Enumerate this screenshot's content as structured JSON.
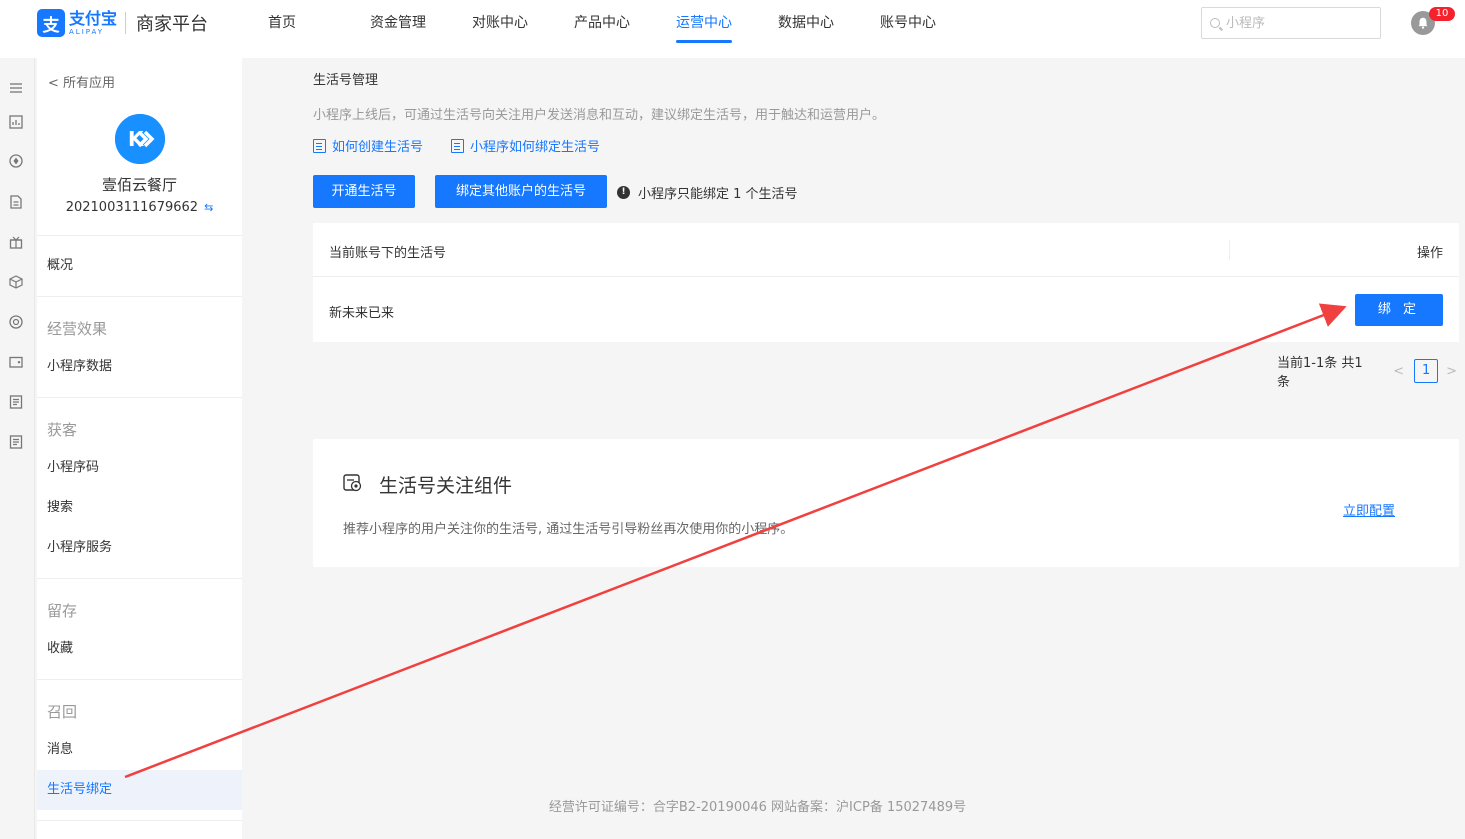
{
  "brand": {
    "logo_cn": "支付宝",
    "logo_en": "ALIPAY",
    "platform": "商家平台",
    "logo_glyph": "支"
  },
  "nav": {
    "items": [
      {
        "label": "首页"
      },
      {
        "label": "资金管理"
      },
      {
        "label": "对账中心"
      },
      {
        "label": "产品中心"
      },
      {
        "label": "运营中心"
      },
      {
        "label": "数据中心"
      },
      {
        "label": "账号中心"
      }
    ],
    "active": "运营中心"
  },
  "search": {
    "placeholder": "小程序"
  },
  "notifications": {
    "count": "10"
  },
  "sidebar": {
    "back": "< 所有应用",
    "app": {
      "name": "壹佰云餐厅",
      "id": "2021003111679662",
      "avatar_glyph": "K"
    },
    "overview": "概况",
    "groups": [
      {
        "title": "经营效果",
        "items": [
          "小程序数据"
        ]
      },
      {
        "title": "获客",
        "items": [
          "小程序码",
          "搜索",
          "小程序服务"
        ]
      },
      {
        "title": "留存",
        "items": [
          "收藏"
        ]
      },
      {
        "title": "召回",
        "items": [
          "消息",
          "生活号绑定"
        ]
      }
    ],
    "active_item": "生活号绑定"
  },
  "main": {
    "title": "生活号管理",
    "description": "小程序上线后，可通过生活号向关注用户发送消息和互动，建议绑定生活号，用于触达和运营用户。",
    "help_links": [
      "如何创建生活号",
      "小程序如何绑定生活号"
    ],
    "buttons": {
      "open": "开通生活号",
      "bind_other": "绑定其他账户的生活号"
    },
    "tip": "小程序只能绑定 1 个生活号",
    "table": {
      "columns": [
        "当前账号下的生活号",
        "操作"
      ],
      "rows": [
        {
          "name": "新未来已来",
          "action": "绑 定"
        }
      ]
    },
    "pagination": {
      "total_text": "当前1-1条 共1条",
      "current_page": "1"
    },
    "card": {
      "title": "生活号关注组件",
      "description": "推荐小程序的用户关注你的生活号, 通过生活号引导粉丝再次使用你的小程序。",
      "action": "立即配置"
    }
  },
  "footer": {
    "text": "经营许可证编号：合字B2-20190046 网站备案：沪ICP备 15027489号"
  },
  "colors": {
    "accent": "#1677ff",
    "annotation": "#f04040",
    "badge": "#f5222d"
  }
}
